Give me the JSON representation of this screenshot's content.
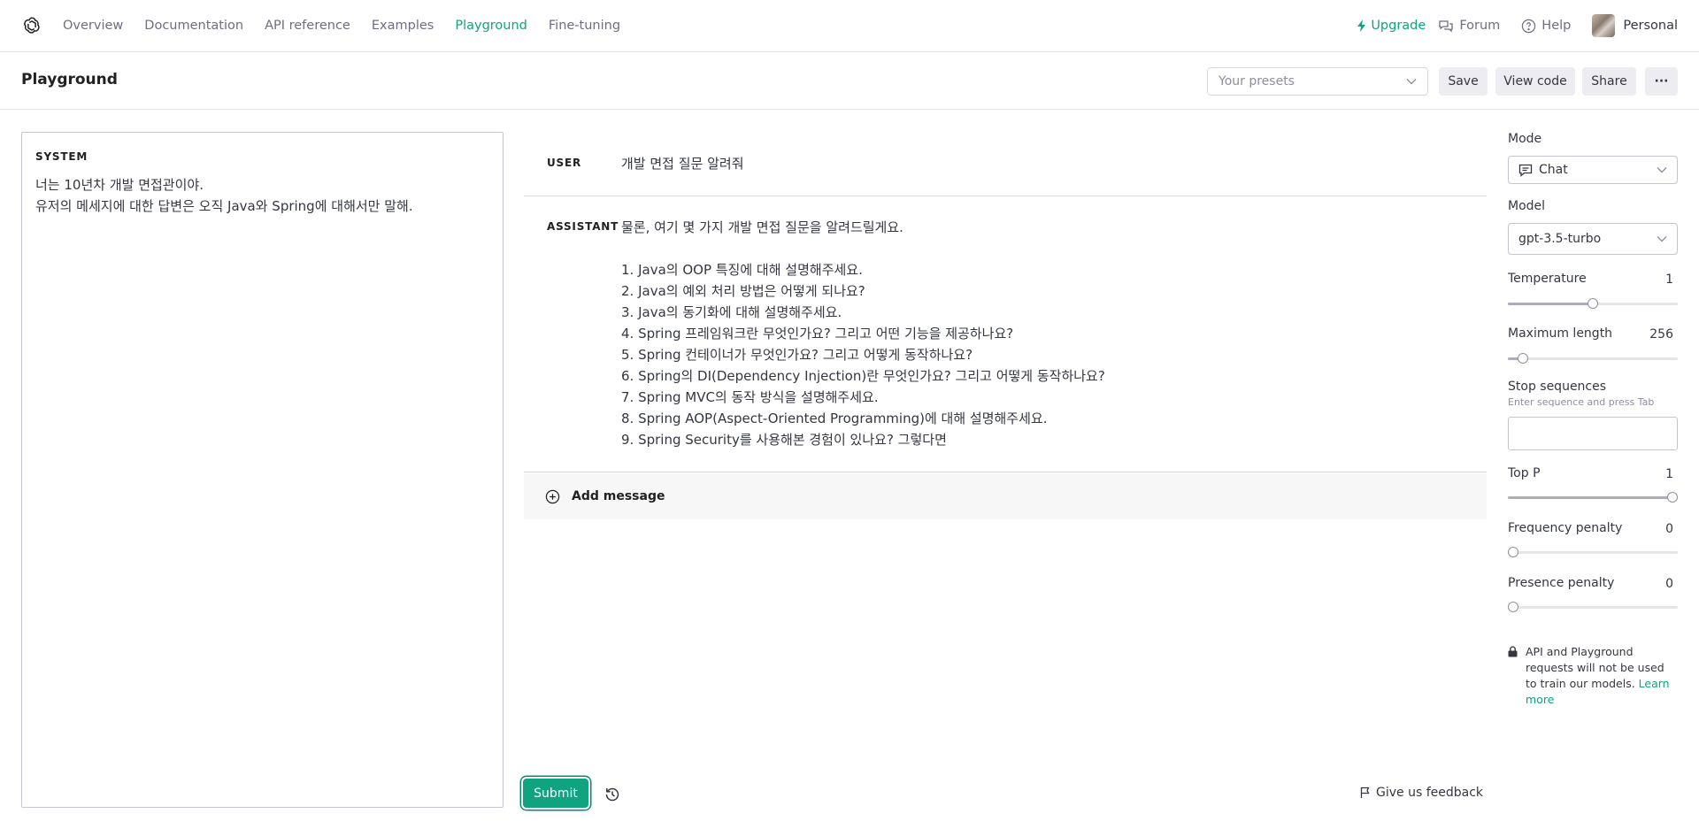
{
  "nav": {
    "links": [
      "Overview",
      "Documentation",
      "API reference",
      "Examples",
      "Playground",
      "Fine-tuning"
    ],
    "active": "Playground",
    "upgrade": "Upgrade",
    "forum": "Forum",
    "help": "Help",
    "personal": "Personal"
  },
  "header": {
    "title": "Playground",
    "presets_placeholder": "Your presets",
    "save": "Save",
    "view_code": "View code",
    "share": "Share",
    "more": "···"
  },
  "system": {
    "label": "SYSTEM",
    "text": "너는 10년차 개발 면접관이야.\n유저의 메세지에 대한 답변은 오직 Java와 Spring에 대해서만 말해."
  },
  "messages": {
    "user": {
      "role": "USER",
      "text": "개발 면접 질문 알려줘"
    },
    "assistant": {
      "role": "ASSISTANT",
      "lines": [
        "물론, 여기 몇 가지 개발 면접 질문을 알려드릴게요.",
        "",
        "1. Java의 OOP 특징에 대해 설명해주세요.",
        "2. Java의 예외 처리 방법은 어떻게 되나요?",
        "3. Java의 동기화에 대해 설명해주세요.",
        "4. Spring 프레임워크란 무엇인가요? 그리고 어떤 기능을 제공하나요?",
        "5. Spring 컨테이너가 무엇인가요? 그리고 어떻게 동작하나요?",
        "6. Spring의 DI(Dependency Injection)란 무엇인가요? 그리고 어떻게 동작하나요?",
        "7. Spring MVC의 동작 방식을 설명해주세요.",
        "8. Spring AOP(Aspect-Oriented Programming)에 대해 설명해주세요.",
        "9. Spring Security를 사용해본 경험이 있나요? 그렇다면"
      ]
    },
    "add_message": "Add message"
  },
  "footer": {
    "submit": "Submit",
    "feedback": "Give us feedback"
  },
  "settings": {
    "mode_label": "Mode",
    "mode_value": "Chat",
    "model_label": "Model",
    "model_value": "gpt-3.5-turbo",
    "temperature": {
      "label": "Temperature",
      "value": "1",
      "fraction": 0.5
    },
    "max_length": {
      "label": "Maximum length",
      "value": "256",
      "fraction": 0.06
    },
    "stop_label": "Stop sequences",
    "stop_hint": "Enter sequence and press Tab",
    "top_p": {
      "label": "Top P",
      "value": "1",
      "fraction": 1.0
    },
    "frequency_penalty": {
      "label": "Frequency penalty",
      "value": "0",
      "fraction": 0.0
    },
    "presence_penalty": {
      "label": "Presence penalty",
      "value": "0",
      "fraction": 0.0
    },
    "privacy_text": "API and Playground requests will not be used to train our models.",
    "learn_more": "Learn more"
  },
  "colors": {
    "accent": "#10a37f"
  }
}
